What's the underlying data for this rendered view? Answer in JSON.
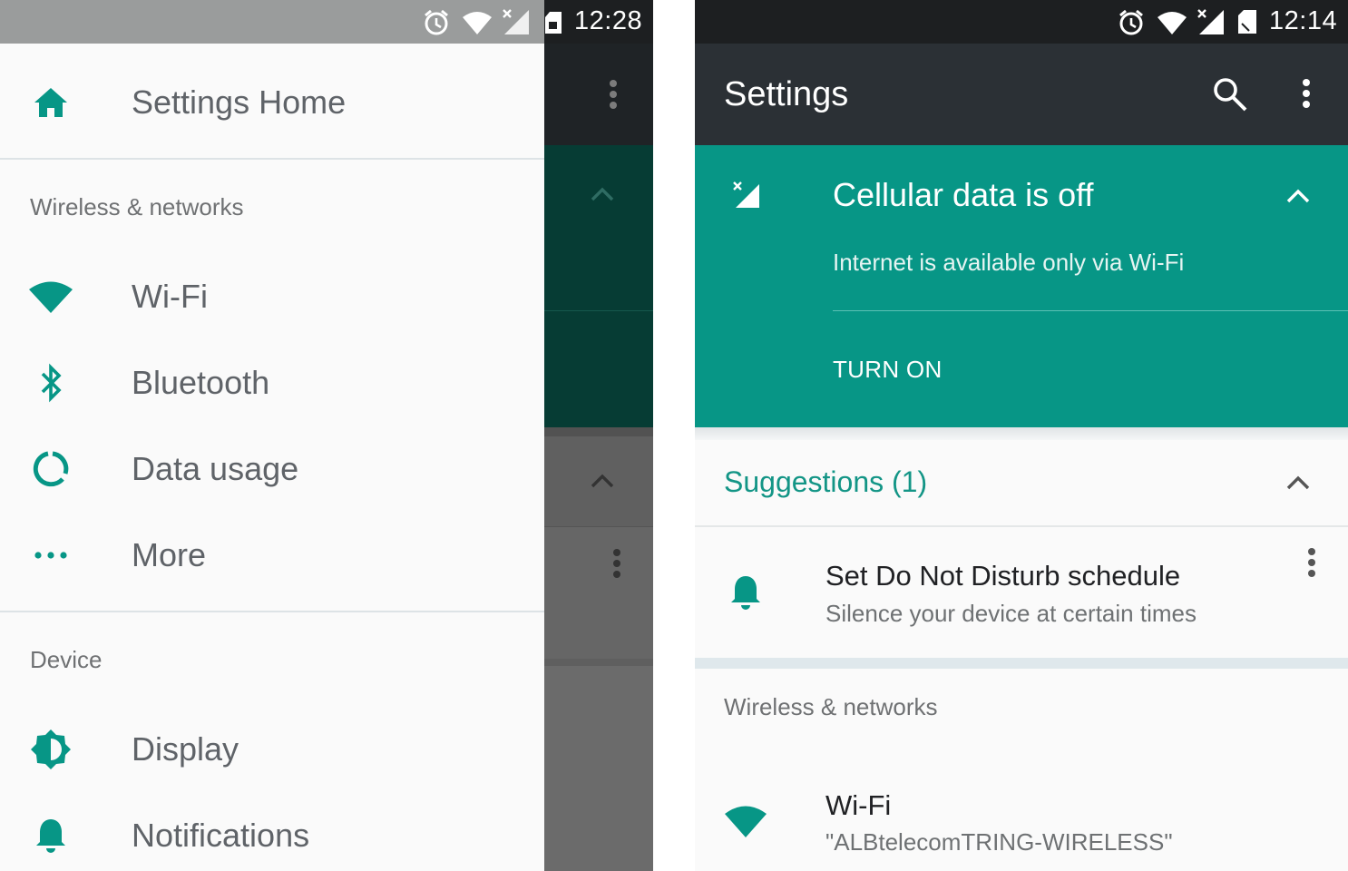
{
  "colors": {
    "accent": "#079686",
    "accent_text": "#139586",
    "drawer_bg": "#fafafa",
    "toolbar": "#2b3035",
    "status_bar": "#1d1f21"
  },
  "left_screen": {
    "status_bar": {
      "time": "12:28",
      "icons": [
        "alarm-icon",
        "wifi-icon",
        "cellular-off-icon",
        "sim-card-icon"
      ]
    },
    "drawer": {
      "home": {
        "label": "Settings Home",
        "icon": "home-icon"
      },
      "sections": [
        {
          "title": "Wireless & networks",
          "items": [
            {
              "label": "Wi-Fi",
              "icon": "wifi-icon"
            },
            {
              "label": "Bluetooth",
              "icon": "bluetooth-icon"
            },
            {
              "label": "Data usage",
              "icon": "data-usage-icon"
            },
            {
              "label": "More",
              "icon": "more-horiz-icon"
            }
          ]
        },
        {
          "title": "Device",
          "items": [
            {
              "label": "Display",
              "icon": "brightness-icon"
            },
            {
              "label": "Notifications",
              "icon": "bell-icon"
            }
          ]
        }
      ]
    }
  },
  "right_screen": {
    "status_bar": {
      "time": "12:14",
      "icons": [
        "alarm-icon",
        "wifi-icon",
        "cellular-off-icon",
        "sim-card-icon"
      ]
    },
    "toolbar": {
      "title": "Settings",
      "actions": [
        "search-icon",
        "overflow-menu-icon"
      ]
    },
    "condition_card": {
      "title": "Cellular data is off",
      "summary": "Internet is available only via Wi-Fi",
      "action": "TURN ON",
      "icon": "cellular-off-icon"
    },
    "suggestions": {
      "title": "Suggestions (1)",
      "items": [
        {
          "title": "Set Do Not Disturb schedule",
          "summary": "Silence your device at certain times",
          "icon": "bell-icon"
        }
      ]
    },
    "section_title": "Wireless & networks",
    "wifi": {
      "title": "Wi-Fi",
      "summary": "\"ALBtelecomTRING-WIRELESS\"",
      "icon": "wifi-icon"
    }
  }
}
